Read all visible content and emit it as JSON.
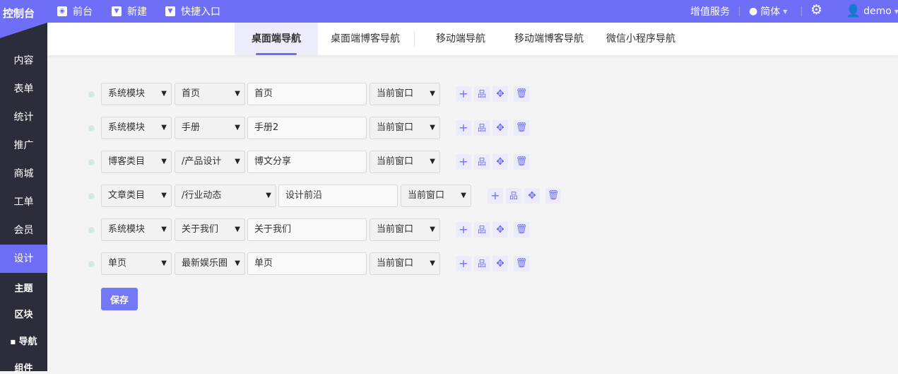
{
  "header": {
    "logo": "控制台",
    "links": [
      {
        "label": "前台",
        "icon": "eye-icon"
      },
      {
        "label": "新建",
        "icon": "caret-down-icon"
      },
      {
        "label": "快捷入口",
        "icon": "caret-down-icon"
      }
    ],
    "value_services": "增值服务",
    "language": "简体",
    "user": "demo"
  },
  "sidebar": {
    "items": [
      "内容",
      "表单",
      "统计",
      "推广",
      "商城",
      "工单",
      "会员",
      "设计"
    ],
    "active": "设计",
    "sub_items": [
      "主题",
      "区块",
      "导航",
      "组件"
    ],
    "active_sub": "导航"
  },
  "tabs": [
    "桌面端导航",
    "桌面端博客导航",
    "移动端导航",
    "移动端博客导航",
    "微信小程序导航"
  ],
  "active_tab": "桌面端导航",
  "rows": [
    {
      "type": "系统模块",
      "target": "首页",
      "name": "首页",
      "window": "当前窗口"
    },
    {
      "type": "系统模块",
      "target": "手册",
      "name": "手册2",
      "window": "当前窗口"
    },
    {
      "type": "博客类目",
      "target": "/产品设计",
      "name": "博文分享",
      "window": "当前窗口"
    },
    {
      "type": "文章类目",
      "target": "/行业动态",
      "name": "设计前沿",
      "window": "当前窗口"
    },
    {
      "type": "系统模块",
      "target": "关于我们",
      "name": "关于我们",
      "window": "当前窗口"
    },
    {
      "type": "单页",
      "target": "最新娱乐圈",
      "name": "单页",
      "window": "当前窗口"
    }
  ],
  "save_label": "保存",
  "colors": {
    "accent": "#6e6ef6",
    "sidebar": "#2b2d3b"
  }
}
